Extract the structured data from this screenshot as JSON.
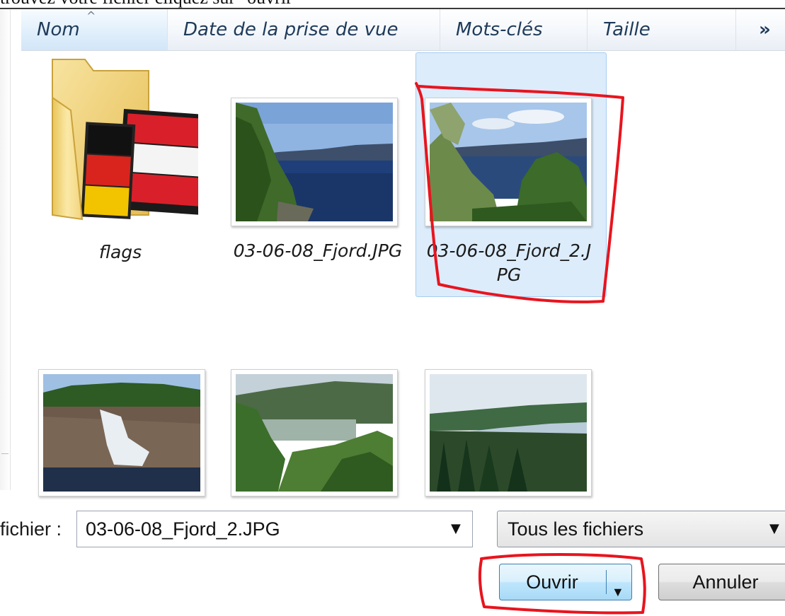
{
  "caption": "trouvez votre fichier cliquez sur \"ouvrir\"",
  "header": {
    "columns": [
      "Nom",
      "Date de la prise de vue",
      "Mots-clés",
      "Taille"
    ],
    "more_glyph": "»"
  },
  "files": [
    {
      "name": "flags",
      "type": "folder"
    },
    {
      "name": "03-06-08_Fjord.JPG",
      "type": "image"
    },
    {
      "name": "03-06-08_Fjord_2.J",
      "name_line2": "PG",
      "type": "image",
      "selected": true
    },
    {
      "name": "",
      "type": "image"
    },
    {
      "name": "",
      "type": "image"
    },
    {
      "name": "",
      "type": "image"
    }
  ],
  "footer": {
    "filename_label": "fichier :",
    "filename_value": "03-06-08_Fjord_2.JPG",
    "filetype_value": "Tous les fichiers",
    "open_button": "Ouvrir",
    "cancel_button": "Annuler"
  },
  "annotation_color": "#e8141e",
  "selection_color": "#dcecfb"
}
